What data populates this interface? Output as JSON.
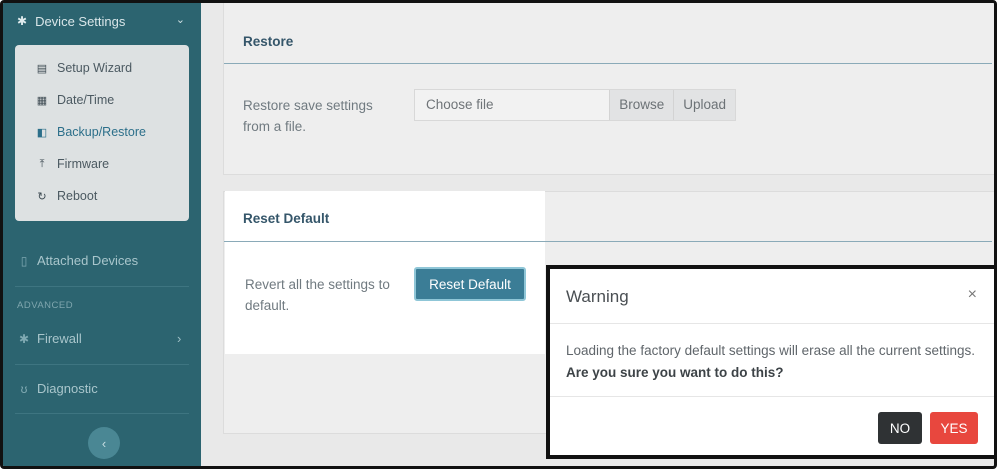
{
  "sidebar": {
    "header": {
      "label": "Device Settings",
      "icon": "gear-icon"
    },
    "submenu": [
      {
        "label": "Setup Wizard",
        "icon": "document-icon"
      },
      {
        "label": "Date/Time",
        "icon": "calendar-icon"
      },
      {
        "label": "Backup/Restore",
        "icon": "copy-icon",
        "active": true
      },
      {
        "label": "Firmware",
        "icon": "upload-icon"
      },
      {
        "label": "Reboot",
        "icon": "refresh-icon"
      }
    ],
    "attached_devices": "Attached Devices",
    "section_advanced": "ADVANCED",
    "firewall": "Firewall",
    "diagnostic": "Diagnostic",
    "collapse_icon": "chevron-left-icon"
  },
  "restore": {
    "title": "Restore",
    "description": "Restore save settings from a file.",
    "file_placeholder": "Choose file",
    "browse_label": "Browse",
    "upload_label": "Upload"
  },
  "reset": {
    "title": "Reset Default",
    "description": "Revert all the settings to default.",
    "button_label": "Reset Default"
  },
  "modal": {
    "title": "Warning",
    "close_glyph": "×",
    "message": "Loading the factory default settings will erase all the current settings.",
    "message_bold": "Are you sure you want to do this?",
    "no_label": "NO",
    "yes_label": "YES"
  },
  "colors": {
    "sidebar": "#2c6470",
    "primary": "#3b7d96",
    "danger": "#e8473e",
    "dark": "#2f3234"
  }
}
